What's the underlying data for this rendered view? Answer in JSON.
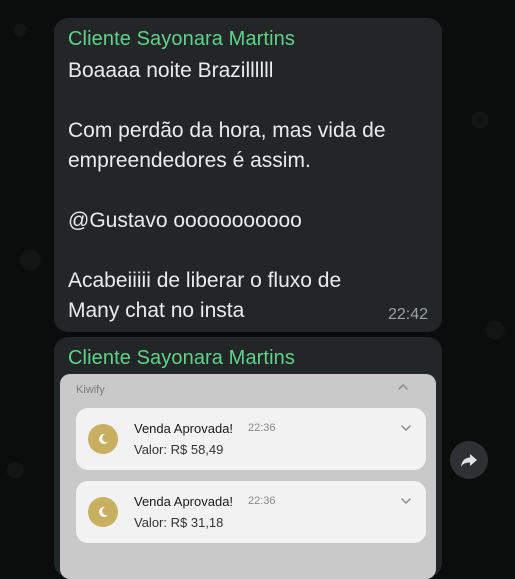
{
  "messages": [
    {
      "sender": "Cliente Sayonara Martins",
      "lines": [
        "Boaaaa noite Brazillllll",
        "",
        "Com perdão da hora, mas vida de",
        "empreendedores é assim.",
        "",
        "@Gustavo ooooooooooo",
        "",
        "Acabeiiiii de liberar o fluxo de",
        "Many chat no insta"
      ],
      "time": "22:42"
    },
    {
      "sender": "Cliente Sayonara Martins",
      "embed": {
        "app_name": "Kiwify",
        "notifications": [
          {
            "title": "Venda Aprovada!",
            "time": "22:36",
            "value": "Valor: R$ 58,49"
          },
          {
            "title": "Venda Aprovada!",
            "time": "22:36",
            "value": "Valor: R$ 31,18"
          }
        ]
      }
    }
  ],
  "colors": {
    "background": "#0b0c0c",
    "bubble": "#232626",
    "sender_name": "#5fd38a",
    "message_text": "#e9ecee",
    "timestamp": "#9aa1a5",
    "notification_card": "#f2f2f2",
    "app_icon": "#c8b060"
  },
  "icons": {
    "forward": "forward-arrow-icon",
    "notification_chevron": "chevron-down-icon",
    "group_collapse": "chevron-up-icon",
    "app_icon": "moon-icon"
  }
}
